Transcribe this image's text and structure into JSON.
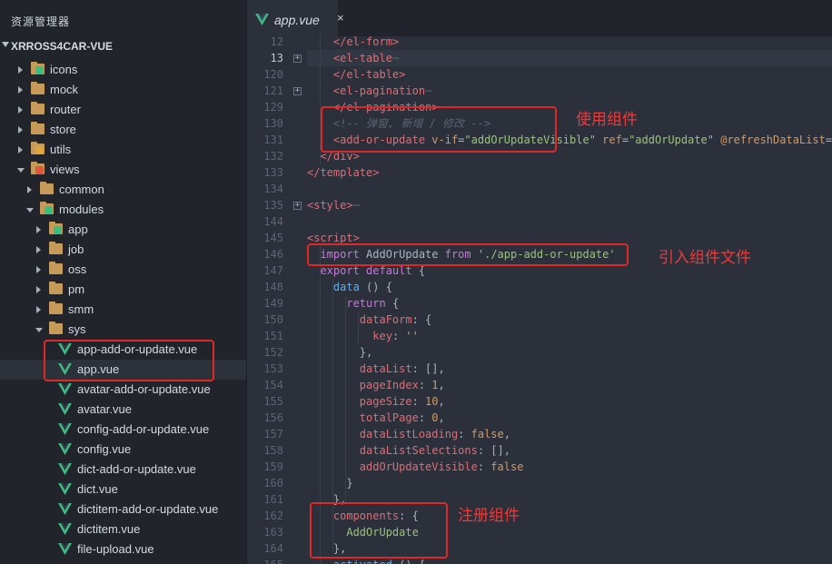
{
  "sidebar": {
    "title": "资源管理器",
    "project": "XRROSS4CAR-VUE",
    "items": [
      {
        "label": "icons",
        "icon": "image-folder-icon",
        "indent": 0,
        "twisty": "closed"
      },
      {
        "label": "mock",
        "icon": "folder-icon",
        "indent": 0,
        "twisty": "closed"
      },
      {
        "label": "router",
        "icon": "folder-icon",
        "indent": 0,
        "twisty": "closed"
      },
      {
        "label": "store",
        "icon": "folder-icon",
        "indent": 0,
        "twisty": "closed"
      },
      {
        "label": "utils",
        "icon": "utils-folder-icon",
        "indent": 0,
        "twisty": "closed"
      },
      {
        "label": "views",
        "icon": "views-folder-icon",
        "indent": 0,
        "twisty": "open"
      },
      {
        "label": "common",
        "icon": "folder-icon",
        "indent": 1,
        "twisty": "closed"
      },
      {
        "label": "modules",
        "icon": "modules-folder-icon",
        "indent": 1,
        "twisty": "open"
      },
      {
        "label": "app",
        "icon": "app-folder-icon",
        "indent": 2,
        "twisty": "closed"
      },
      {
        "label": "job",
        "icon": "folder-icon",
        "indent": 2,
        "twisty": "closed"
      },
      {
        "label": "oss",
        "icon": "folder-icon",
        "indent": 2,
        "twisty": "closed"
      },
      {
        "label": "pm",
        "icon": "folder-icon",
        "indent": 2,
        "twisty": "closed"
      },
      {
        "label": "smm",
        "icon": "folder-icon",
        "indent": 2,
        "twisty": "closed"
      },
      {
        "label": "sys",
        "icon": "folder-icon",
        "indent": 2,
        "twisty": "open"
      },
      {
        "label": "app-add-or-update.vue",
        "icon": "vue-file-icon",
        "indent": 3,
        "twisty": "none"
      },
      {
        "label": "app.vue",
        "icon": "vue-file-icon",
        "indent": 3,
        "twisty": "none",
        "selected": true
      },
      {
        "label": "avatar-add-or-update.vue",
        "icon": "vue-file-icon",
        "indent": 3,
        "twisty": "none"
      },
      {
        "label": "avatar.vue",
        "icon": "vue-file-icon",
        "indent": 3,
        "twisty": "none"
      },
      {
        "label": "config-add-or-update.vue",
        "icon": "vue-file-icon",
        "indent": 3,
        "twisty": "none"
      },
      {
        "label": "config.vue",
        "icon": "vue-file-icon",
        "indent": 3,
        "twisty": "none"
      },
      {
        "label": "dict-add-or-update.vue",
        "icon": "vue-file-icon",
        "indent": 3,
        "twisty": "none"
      },
      {
        "label": "dict.vue",
        "icon": "vue-file-icon",
        "indent": 3,
        "twisty": "none"
      },
      {
        "label": "dictitem-add-or-update.vue",
        "icon": "vue-file-icon",
        "indent": 3,
        "twisty": "none"
      },
      {
        "label": "dictitem.vue",
        "icon": "vue-file-icon",
        "indent": 3,
        "twisty": "none"
      },
      {
        "label": "file-upload.vue",
        "icon": "vue-file-icon",
        "indent": 3,
        "twisty": "none"
      }
    ]
  },
  "tab": {
    "label": "app.vue",
    "close": "×",
    "icon": "vue-file-icon"
  },
  "code": {
    "current_line": "13",
    "lines": [
      {
        "no": "12",
        "fold": false,
        "tokens": [
          [
            "p",
            "    "
          ],
          [
            "t",
            "</el-form>"
          ]
        ]
      },
      {
        "no": "13",
        "fold": true,
        "tokens": [
          [
            "p",
            "    "
          ],
          [
            "t",
            "<el-table"
          ],
          [
            "c",
            "⋯"
          ]
        ]
      },
      {
        "no": "120",
        "fold": false,
        "tokens": [
          [
            "p",
            "    "
          ],
          [
            "t",
            "</el-table>"
          ]
        ]
      },
      {
        "no": "121",
        "fold": true,
        "tokens": [
          [
            "p",
            "    "
          ],
          [
            "t",
            "<el-pagination"
          ],
          [
            "c",
            "⋯"
          ]
        ]
      },
      {
        "no": "129",
        "fold": false,
        "tokens": [
          [
            "p",
            "    "
          ],
          [
            "t",
            "</el-pagination>"
          ]
        ]
      },
      {
        "no": "130",
        "fold": false,
        "tokens": [
          [
            "p",
            "    "
          ],
          [
            "c",
            "<!-- 弹窗, 新增 / 修改 -->"
          ]
        ]
      },
      {
        "no": "131",
        "fold": false,
        "tokens": [
          [
            "p",
            "    "
          ],
          [
            "t",
            "<add-or-update "
          ],
          [
            "a",
            "v-if"
          ],
          [
            "p",
            "="
          ],
          [
            "s",
            "\"addOrUpdateVisible\""
          ],
          [
            "p",
            " "
          ],
          [
            "a",
            "ref"
          ],
          [
            "p",
            "="
          ],
          [
            "s",
            "\"addOrUpdate\""
          ],
          [
            "p",
            " "
          ],
          [
            "a",
            "@refreshDataList"
          ],
          [
            "p",
            "="
          ]
        ]
      },
      {
        "no": "132",
        "fold": false,
        "tokens": [
          [
            "p",
            "  "
          ],
          [
            "t",
            "</div>"
          ]
        ]
      },
      {
        "no": "133",
        "fold": false,
        "tokens": [
          [
            "t",
            "</template>"
          ]
        ]
      },
      {
        "no": "134",
        "fold": false,
        "tokens": []
      },
      {
        "no": "135",
        "fold": true,
        "tokens": [
          [
            "t",
            "<style>"
          ],
          [
            "c",
            "⋯"
          ]
        ]
      },
      {
        "no": "144",
        "fold": false,
        "tokens": []
      },
      {
        "no": "145",
        "fold": false,
        "tokens": [
          [
            "t",
            "<script>"
          ]
        ]
      },
      {
        "no": "146",
        "fold": false,
        "tokens": [
          [
            "p",
            "  "
          ],
          [
            "k",
            "import"
          ],
          [
            "p",
            " AddOrUpdate "
          ],
          [
            "k",
            "from"
          ],
          [
            "p",
            " "
          ],
          [
            "s",
            "'./app-add-or-update'"
          ]
        ]
      },
      {
        "no": "147",
        "fold": false,
        "tokens": [
          [
            "p",
            "  "
          ],
          [
            "k",
            "export default"
          ],
          [
            "p",
            " {"
          ]
        ]
      },
      {
        "no": "148",
        "fold": false,
        "tokens": [
          [
            "p",
            "    "
          ],
          [
            "f",
            "data"
          ],
          [
            "p",
            " () {"
          ]
        ]
      },
      {
        "no": "149",
        "fold": false,
        "tokens": [
          [
            "p",
            "      "
          ],
          [
            "k",
            "return"
          ],
          [
            "p",
            " {"
          ]
        ]
      },
      {
        "no": "150",
        "fold": false,
        "tokens": [
          [
            "p",
            "        "
          ],
          [
            "pr",
            "dataForm"
          ],
          [
            "p",
            ": {"
          ]
        ]
      },
      {
        "no": "151",
        "fold": false,
        "tokens": [
          [
            "p",
            "          "
          ],
          [
            "pr",
            "key"
          ],
          [
            "p",
            ": "
          ],
          [
            "s",
            "''"
          ]
        ]
      },
      {
        "no": "152",
        "fold": false,
        "tokens": [
          [
            "p",
            "        },"
          ]
        ]
      },
      {
        "no": "153",
        "fold": false,
        "tokens": [
          [
            "p",
            "        "
          ],
          [
            "pr",
            "dataList"
          ],
          [
            "p",
            ": [],"
          ]
        ]
      },
      {
        "no": "154",
        "fold": false,
        "tokens": [
          [
            "p",
            "        "
          ],
          [
            "pr",
            "pageIndex"
          ],
          [
            "p",
            ": "
          ],
          [
            "n",
            "1"
          ],
          [
            "p",
            ","
          ]
        ]
      },
      {
        "no": "155",
        "fold": false,
        "tokens": [
          [
            "p",
            "        "
          ],
          [
            "pr",
            "pageSize"
          ],
          [
            "p",
            ": "
          ],
          [
            "n",
            "10"
          ],
          [
            "p",
            ","
          ]
        ]
      },
      {
        "no": "156",
        "fold": false,
        "tokens": [
          [
            "p",
            "        "
          ],
          [
            "pr",
            "totalPage"
          ],
          [
            "p",
            ": "
          ],
          [
            "n",
            "0"
          ],
          [
            "p",
            ","
          ]
        ]
      },
      {
        "no": "157",
        "fold": false,
        "tokens": [
          [
            "p",
            "        "
          ],
          [
            "pr",
            "dataListLoading"
          ],
          [
            "p",
            ": "
          ],
          [
            "n",
            "false"
          ],
          [
            "p",
            ","
          ]
        ]
      },
      {
        "no": "158",
        "fold": false,
        "tokens": [
          [
            "p",
            "        "
          ],
          [
            "pr",
            "dataListSelections"
          ],
          [
            "p",
            ": [],"
          ]
        ]
      },
      {
        "no": "159",
        "fold": false,
        "tokens": [
          [
            "p",
            "        "
          ],
          [
            "pr",
            "addOrUpdateVisible"
          ],
          [
            "p",
            ": "
          ],
          [
            "n",
            "false"
          ]
        ]
      },
      {
        "no": "160",
        "fold": false,
        "tokens": [
          [
            "p",
            "      }"
          ]
        ]
      },
      {
        "no": "161",
        "fold": false,
        "tokens": [
          [
            "p",
            "    },"
          ]
        ]
      },
      {
        "no": "162",
        "fold": false,
        "tokens": [
          [
            "p",
            "    "
          ],
          [
            "pr",
            "components"
          ],
          [
            "p",
            ": {"
          ]
        ]
      },
      {
        "no": "163",
        "fold": false,
        "tokens": [
          [
            "p",
            "      "
          ],
          [
            "s",
            "AddOrUpdate"
          ]
        ]
      },
      {
        "no": "164",
        "fold": false,
        "tokens": [
          [
            "p",
            "    },"
          ]
        ]
      },
      {
        "no": "165",
        "fold": false,
        "tokens": [
          [
            "p",
            "    "
          ],
          [
            "f",
            "activated"
          ],
          [
            "p",
            " () {"
          ]
        ]
      }
    ]
  },
  "annotations": {
    "use_component": "使用组件",
    "import_component": "引入组件文件",
    "register_component": "注册组件"
  },
  "colors": {
    "highlight_box": "#e02828",
    "annotation_text": "#ec3b3b",
    "vue_green": "#42b883",
    "folder": "#c69a58"
  }
}
